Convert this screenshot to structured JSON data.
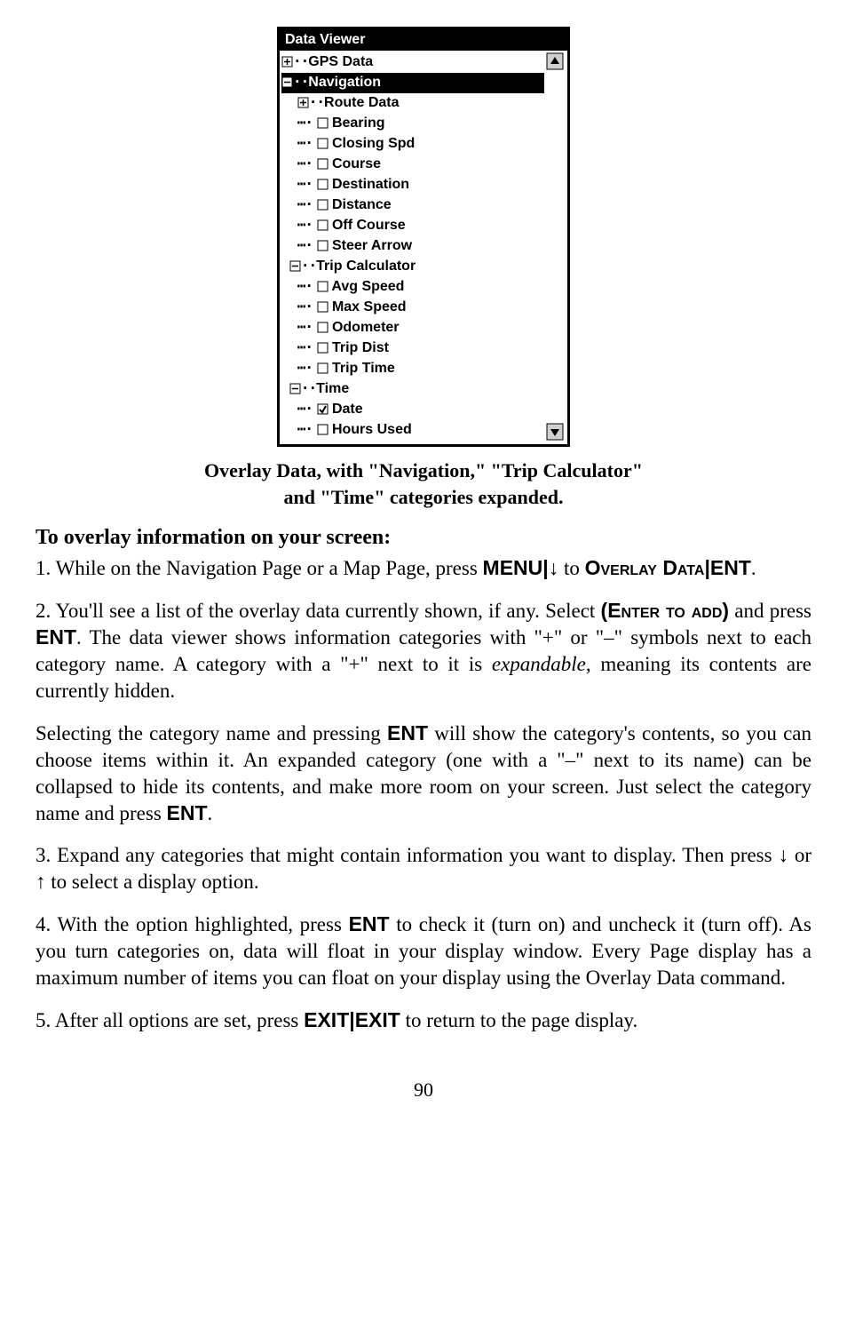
{
  "viewer": {
    "title": "Data Viewer",
    "tree": {
      "gps_data": "GPS Data",
      "navigation": "Navigation",
      "route_data": "Route Data",
      "bearing": "Bearing",
      "closing_spd": "Closing Spd",
      "course": "Course",
      "destination": "Destination",
      "distance": "Distance",
      "off_course": "Off Course",
      "steer_arrow": "Steer Arrow",
      "trip_calculator": "Trip Calculator",
      "avg_speed": "Avg Speed",
      "max_speed": "Max Speed",
      "odometer": "Odometer",
      "trip_dist": "Trip Dist",
      "trip_time": "Trip Time",
      "time": "Time",
      "date": "Date",
      "hours_used": "Hours Used"
    }
  },
  "caption": {
    "line1": "Overlay Data, with \"Navigation,\" \"Trip Calculator\"",
    "line2": "and \"Time\" categories expanded."
  },
  "heading": "To overlay information on your screen:",
  "step1": {
    "t1": "1. While on the Navigation Page or a Map Page, press ",
    "menu": "MENU",
    "pipe": "|",
    "arrow_down": "↓",
    "to": " to ",
    "overlay_data": "Overlay Data",
    "ent": "ENT",
    "period": "."
  },
  "step2": {
    "t1": "2. You'll see a list of the overlay data currently shown, if any. Select ",
    "enter_to_add": "(Enter to add)",
    "t2": " and press ",
    "ent": "ENT",
    "t3": ". The data viewer shows information categories with \"+\" or \"–\" symbols next to each category name. A category with a \"+\" next to it is ",
    "expandable": "expandable",
    "t4": ", meaning its contents are currently hidden."
  },
  "para_sel": {
    "t1": "Selecting the category name and pressing ",
    "ent": "ENT",
    "t2": " will show the category's contents, so you can choose items within it. An expanded category (one with a \"–\" next to its name) can be collapsed to hide its contents, and make more room on your screen. Just select the category name and press ",
    "ent2": "ENT",
    "t3": "."
  },
  "step3": {
    "t1": "3. Expand any categories that might contain information you want to display. Then press ",
    "arrow_down": "↓",
    "or": " or ",
    "arrow_up": "↑",
    "t2": " to select a display option."
  },
  "step4": {
    "t1": "4. With the option highlighted, press ",
    "ent": "ENT",
    "t2": " to check it (turn on) and uncheck it (turn off). As you turn categories on, data will float in your display window. Every Page display has a maximum number of items you can float on your display using the Overlay Data command."
  },
  "step5": {
    "t1": "5. After all options are set, press ",
    "exit1": "EXIT",
    "pipe": "|",
    "exit2": "EXIT",
    "t2": " to return to the page display."
  },
  "pagenum": "90"
}
